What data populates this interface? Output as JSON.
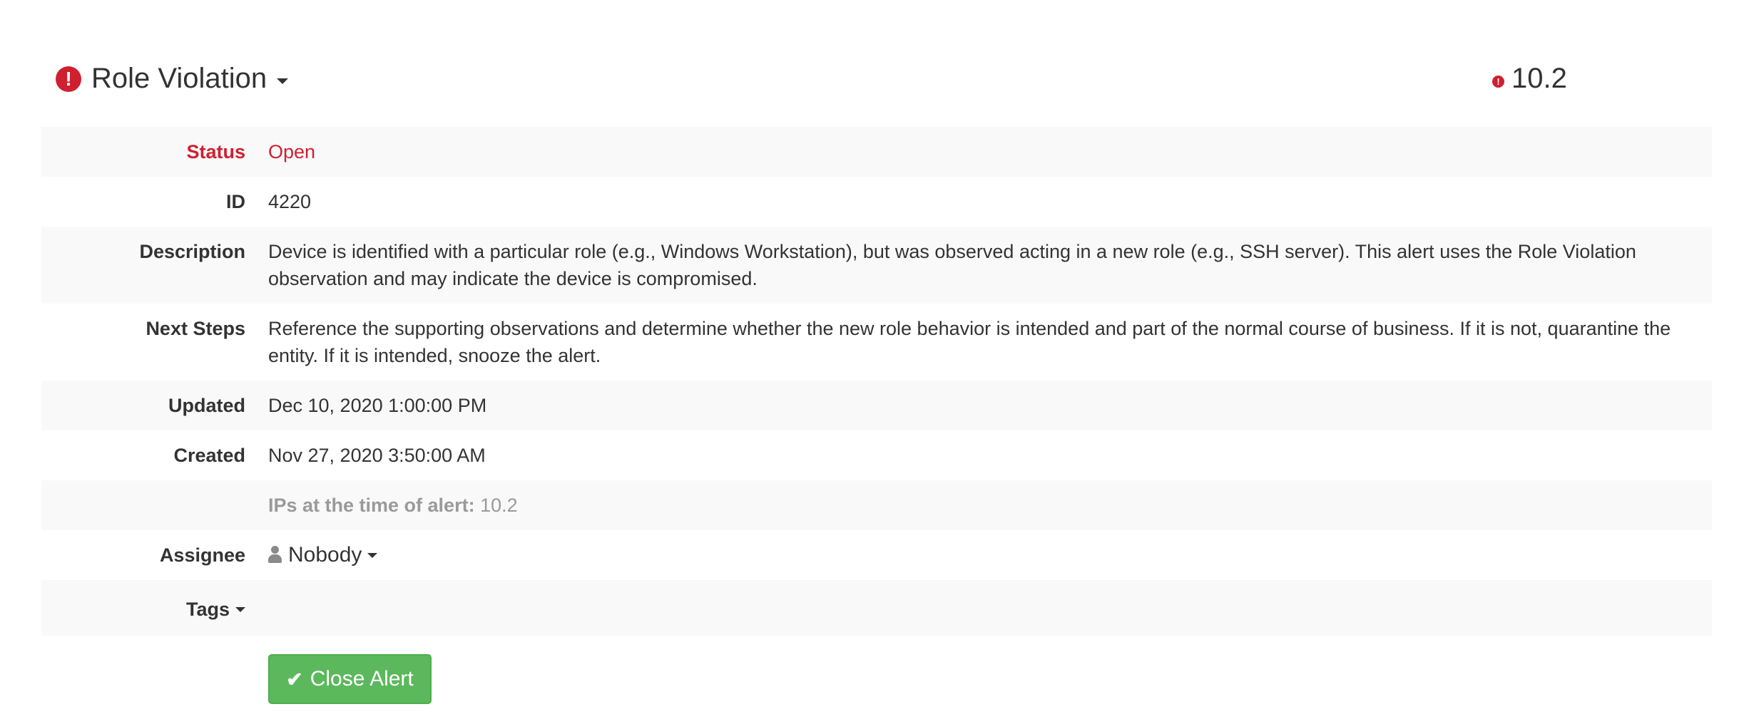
{
  "header": {
    "title": "Role Violation",
    "alert_icon": "!",
    "score_icon": "!",
    "score": "10.2"
  },
  "details": {
    "status_label": "Status",
    "status_value": "Open",
    "id_label": "ID",
    "id_value": "4220",
    "description_label": "Description",
    "description_value": "Device is identified with a particular role (e.g., Windows Workstation), but was observed acting in a new role (e.g., SSH server). This alert uses the Role Violation observation and may indicate the device is compromised.",
    "next_steps_label": "Next Steps",
    "next_steps_value": "Reference the supporting observations and determine whether the new role behavior is intended and part of the normal course of business. If it is not, quarantine the entity. If it is intended, snooze the alert.",
    "updated_label": "Updated",
    "updated_value": "Dec 10, 2020 1:00:00 PM",
    "created_label": "Created",
    "created_value": "Nov 27, 2020 3:50:00 AM",
    "ips_label": "IPs at the time of alert:",
    "ips_value": "10.2",
    "assignee_label": "Assignee",
    "assignee_value": "Nobody",
    "tags_label": "Tags"
  },
  "actions": {
    "close_label": "Close Alert",
    "close_icon": "✔"
  },
  "colors": {
    "alert_red": "#cf2030",
    "success_green": "#5cb85c",
    "row_shade": "#f9f9f9"
  }
}
